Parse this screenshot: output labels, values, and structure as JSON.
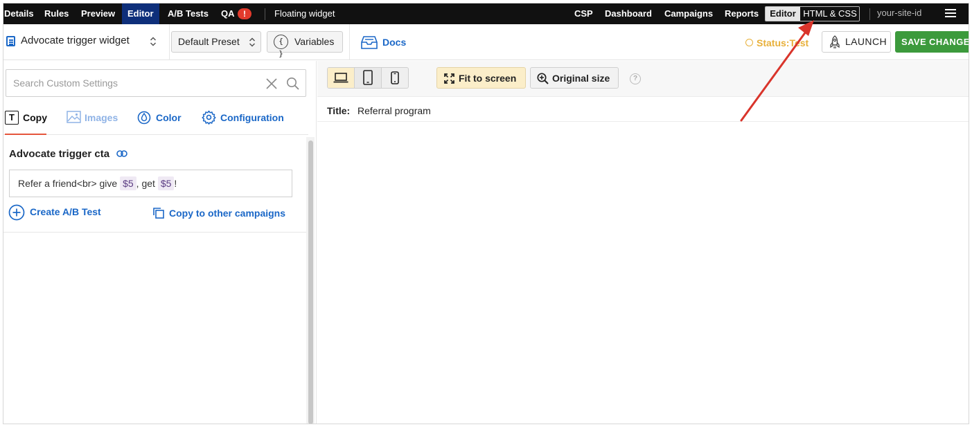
{
  "topnav": {
    "items": [
      {
        "label": "Details"
      },
      {
        "label": "Rules"
      },
      {
        "label": "Preview"
      },
      {
        "label": "Editor",
        "active": true
      },
      {
        "label": "A/B Tests"
      },
      {
        "label": "QA"
      }
    ],
    "qa_badge": "!",
    "campaign_type": "Floating widget",
    "right_items": [
      {
        "label": "CSP"
      },
      {
        "label": "Dashboard"
      },
      {
        "label": "Campaigns"
      },
      {
        "label": "Reports"
      }
    ],
    "editor_toggle": {
      "editor": "Editor",
      "html_css": "HTML & CSS",
      "selected": "Editor"
    },
    "site_id": "your-site-id",
    "menu_icon": "hamburger-icon"
  },
  "toolbar": {
    "widget_name": "Advocate trigger widget",
    "preset": "Default Preset",
    "variables_label": "Variables",
    "docs_label": "Docs",
    "status_text": "Status:Test",
    "launch_label": "LAUNCH",
    "save_label": "SAVE CHANGES"
  },
  "left_panel": {
    "search_placeholder": "Search Custom Settings",
    "tabs": [
      {
        "label": "Copy",
        "active": true
      },
      {
        "label": "Images"
      },
      {
        "label": "Color"
      },
      {
        "label": "Configuration"
      }
    ],
    "setting": {
      "title": "Advocate trigger cta",
      "value_parts": {
        "p1": "Refer a friend<br> give ",
        "v1": "$5",
        "p2": ", get ",
        "v2": "$5",
        "p3": "!"
      }
    },
    "create_ab_label": "Create A/B Test",
    "copy_other_label": "Copy to other campaigns"
  },
  "preview": {
    "fit_label": "Fit to screen",
    "original_label": "Original size",
    "help": "?",
    "title_key": "Title:",
    "title_value": "Referral program",
    "selected_device": "desktop"
  },
  "colors": {
    "topbar_bg": "#111111",
    "active_nav_bg": "#0e2f7a",
    "link_blue": "#1a67c7",
    "save_green": "#3c9a3c",
    "status_amber": "#e8b03a",
    "annotation_red": "#d9342b"
  }
}
